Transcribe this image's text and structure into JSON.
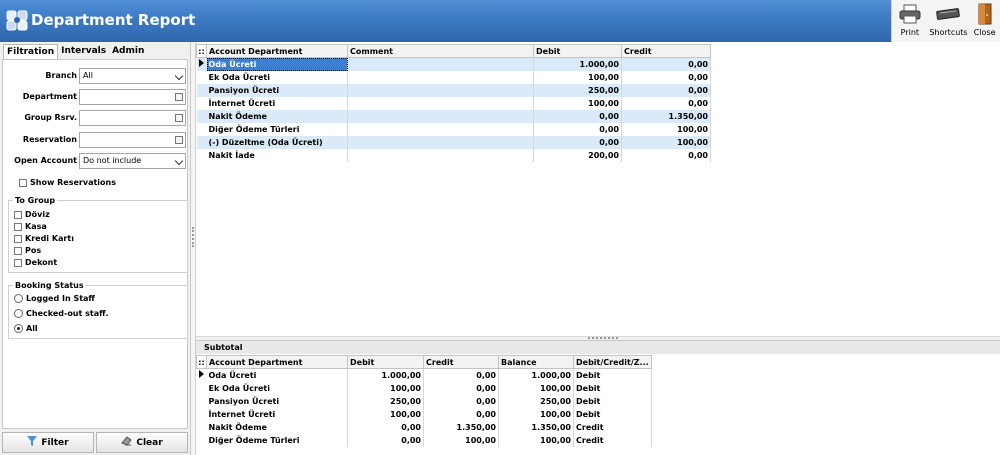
{
  "header": {
    "title": "Department Report",
    "toolbar": [
      {
        "label": "Print",
        "icon": "printer-icon"
      },
      {
        "label": "Shortcuts",
        "icon": "keyboard-icon"
      },
      {
        "label": "Close",
        "icon": "door-exit-icon"
      }
    ]
  },
  "left": {
    "tabs": [
      "Filtration",
      "Intervals",
      "Admin"
    ],
    "fields": {
      "branch": {
        "label": "Branch",
        "value": "All"
      },
      "department": {
        "label": "Department",
        "value": ""
      },
      "group_rsrv": {
        "label": "Group Rsrv.",
        "value": ""
      },
      "reservation": {
        "label": "Reservation",
        "value": ""
      },
      "open_account": {
        "label": "Open Account",
        "value": "Do not include"
      }
    },
    "show_reservations": "Show Reservations",
    "to_group": {
      "title": "To Group",
      "items": [
        "Döviz",
        "Kasa",
        "Kredi Kartı",
        "Pos",
        "Dekont"
      ]
    },
    "booking_status": {
      "title": "Booking Status",
      "options": [
        "Logged In Staff",
        "Checked-out staff.",
        "All"
      ],
      "selected": "All"
    },
    "buttons": {
      "filter": "Filter",
      "clear": "Clear"
    }
  },
  "main_grid": {
    "columns": [
      "Account Department",
      "Comment",
      "Debit",
      "Credit"
    ],
    "rows": [
      [
        "Oda Ücreti",
        "",
        "1.000,00",
        "0,00"
      ],
      [
        "Ek Oda Ücreti",
        "",
        "100,00",
        "0,00"
      ],
      [
        "Pansiyon Ücreti",
        "",
        "250,00",
        "0,00"
      ],
      [
        "İnternet Ücreti",
        "",
        "100,00",
        "0,00"
      ],
      [
        "Nakit Ödeme",
        "",
        "0,00",
        "1.350,00"
      ],
      [
        "Diğer Ödeme Türleri",
        "",
        "0,00",
        "100,00"
      ],
      [
        "(-) Düzeltme (Oda Ücreti)",
        "",
        "0,00",
        "100,00"
      ],
      [
        "Nakit İade",
        "",
        "200,00",
        "0,00"
      ]
    ]
  },
  "subtotal": {
    "title": "Subtotal",
    "columns": [
      "Account Department",
      "Debit",
      "Credit",
      "Balance",
      "Debit/Credit/Z..."
    ],
    "rows": [
      [
        "Oda Ücreti",
        "1.000,00",
        "0,00",
        "1.000,00",
        "Debit"
      ],
      [
        "Ek Oda Ücreti",
        "100,00",
        "0,00",
        "100,00",
        "Debit"
      ],
      [
        "Pansiyon Ücreti",
        "250,00",
        "0,00",
        "250,00",
        "Debit"
      ],
      [
        "İnternet Ücreti",
        "100,00",
        "0,00",
        "100,00",
        "Debit"
      ],
      [
        "Nakit Ödeme",
        "0,00",
        "1.350,00",
        "1.350,00",
        "Credit"
      ],
      [
        "Diğer Ödeme Türleri",
        "0,00",
        "100,00",
        "100,00",
        "Credit"
      ]
    ]
  }
}
